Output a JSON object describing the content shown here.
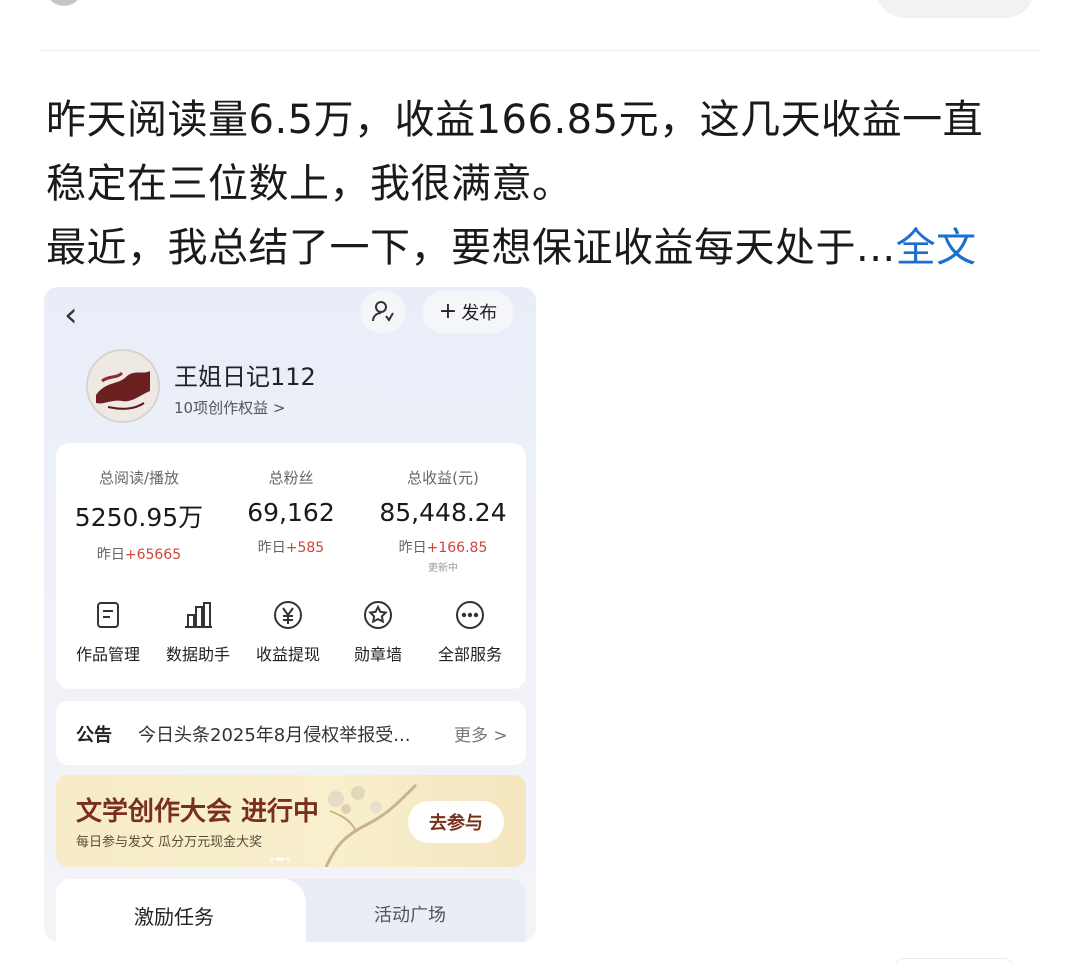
{
  "post": {
    "line1": "昨天阅读量6.5万，收益166.85元，这几天收益一直",
    "line2": "稳定在三位数上，我很满意。",
    "line3": "最近，我总结了一下，要想保证收益每天处于...",
    "full_text_link": "全文"
  },
  "screenshot": {
    "back_icon": "‹",
    "publish_label": "发布",
    "username": "王姐日记112",
    "rights": "10项创作权益 >",
    "stats": [
      {
        "label": "总阅读/播放",
        "value": "5250.95万",
        "delta_prefix": "昨日",
        "delta": "+65665"
      },
      {
        "label": "总粉丝",
        "value": "69,162",
        "delta_prefix": "昨日",
        "delta": "+585"
      },
      {
        "label": "总收益(元)",
        "value": "85,448.24",
        "delta_prefix": "昨日",
        "delta": "+166.85",
        "note": "更新中"
      }
    ],
    "services": [
      {
        "label": "作品管理",
        "icon": "document-icon"
      },
      {
        "label": "数据助手",
        "icon": "bar-chart-icon"
      },
      {
        "label": "收益提现",
        "icon": "yuan-coin-icon"
      },
      {
        "label": "勋章墙",
        "icon": "medal-icon"
      },
      {
        "label": "全部服务",
        "icon": "more-dots-icon"
      }
    ],
    "notice": {
      "tag": "公告",
      "text": "今日头条2025年8月侵权举报受...",
      "more": "更多 >"
    },
    "banner": {
      "title": "文学创作大会 进行中",
      "subtitle": "每日参与发文 瓜分万元现金大奖",
      "button": "去参与"
    },
    "tabs": [
      "激励任务",
      "活动广场"
    ]
  }
}
